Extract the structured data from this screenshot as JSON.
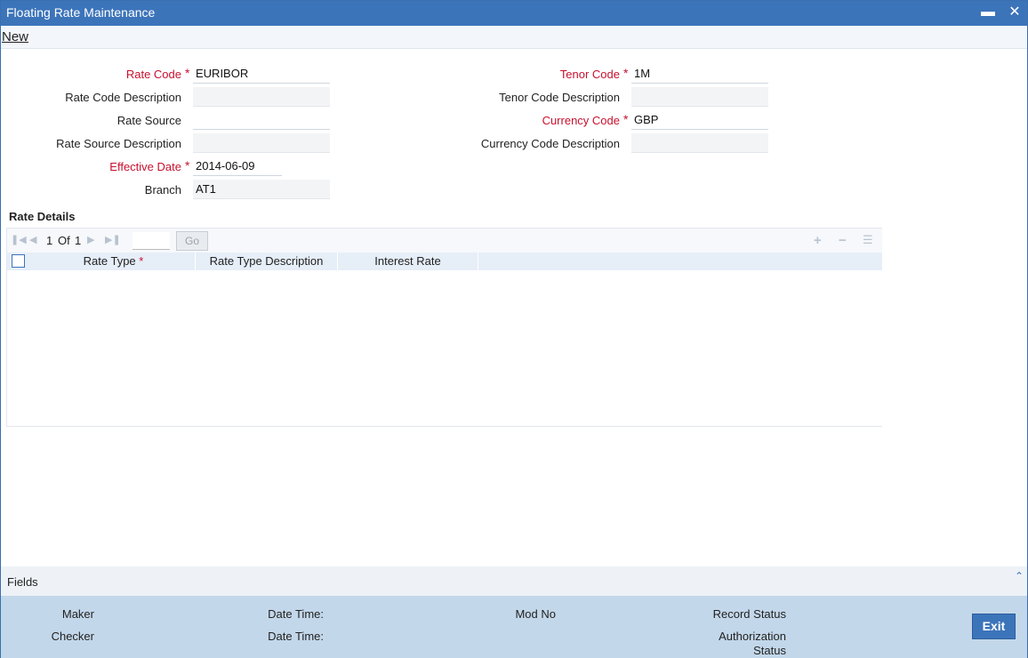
{
  "window": {
    "title": "Floating Rate Maintenance",
    "minimize_icon": "minimize-icon",
    "close_icon": "close-icon"
  },
  "menu": {
    "new_label": "New"
  },
  "form": {
    "rate_code": {
      "label": "Rate Code",
      "value": "EURIBOR",
      "required": true
    },
    "rate_code_desc": {
      "label": "Rate Code Description",
      "value": ""
    },
    "rate_source": {
      "label": "Rate Source",
      "value": ""
    },
    "rate_source_desc": {
      "label": "Rate Source Description",
      "value": ""
    },
    "effective_date": {
      "label": "Effective Date",
      "value": "2014-06-09",
      "required": true
    },
    "branch": {
      "label": "Branch",
      "value": "AT1"
    },
    "tenor_code": {
      "label": "Tenor Code",
      "value": "1M",
      "required": true
    },
    "tenor_code_desc": {
      "label": "Tenor Code Description",
      "value": ""
    },
    "currency_code": {
      "label": "Currency Code",
      "value": "GBP",
      "required": true
    },
    "currency_code_desc": {
      "label": "Currency Code Description",
      "value": ""
    },
    "required_marker": "*"
  },
  "rate_details": {
    "title": "Rate Details",
    "pagination": {
      "current": "1",
      "of_label": "Of",
      "total": "1",
      "go_label": "Go"
    },
    "columns": [
      "Rate Type",
      "Rate Type Description",
      "Interest Rate"
    ],
    "rows": []
  },
  "fields_bar": {
    "label": "Fields"
  },
  "footer": {
    "maker": "Maker",
    "checker": "Checker",
    "date_time_1": "Date Time:",
    "date_time_2": "Date Time:",
    "mod_no": "Mod No",
    "record_status": "Record Status",
    "authorization_status_1": "Authorization",
    "authorization_status_2": "Status",
    "exit_label": "Exit"
  },
  "colors": {
    "title_bar": "#3c74ba",
    "required": "#c8102e",
    "footer": "#c3d7ea",
    "exit_button": "#3c74ba"
  }
}
